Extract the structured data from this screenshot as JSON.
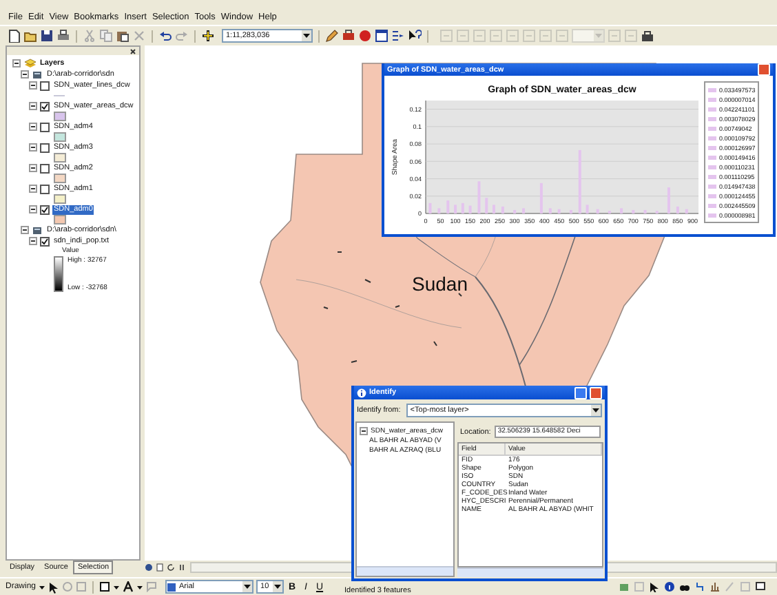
{
  "menu": [
    "File",
    "Edit",
    "View",
    "Bookmarks",
    "Insert",
    "Selection",
    "Tools",
    "Window",
    "Help"
  ],
  "standard_toolbar": {
    "scale": "1:11,283,036"
  },
  "editor_toolbar": {
    "disabled": true
  },
  "toc": {
    "tree": [
      {
        "label": "Layers",
        "kind": "frame",
        "expanded": true,
        "children": [
          {
            "label": "D:\\arab-corridor\\sdn",
            "kind": "folder",
            "expanded": true,
            "children": [
              {
                "label": "SDN_water_lines_dcw",
                "kind": "line-layer",
                "expanded": true,
                "checked": false,
                "selected": false,
                "color": "#c8c8d8"
              },
              {
                "label": "SDN_water_areas_dcw",
                "kind": "polygon-layer",
                "expanded": true,
                "checked": true,
                "selected": false,
                "color": "#d8c4ec"
              },
              {
                "label": "SDN_adm4",
                "kind": "polygon-layer",
                "expanded": true,
                "checked": false,
                "selected": false,
                "color": "#c4e6de"
              },
              {
                "label": "SDN_adm3",
                "kind": "polygon-layer",
                "expanded": true,
                "checked": false,
                "selected": false,
                "color": "#f4ecd6"
              },
              {
                "label": "SDN_adm2",
                "kind": "polygon-layer",
                "expanded": true,
                "checked": false,
                "selected": false,
                "color": "#f4d8c4"
              },
              {
                "label": "SDN_adm1",
                "kind": "polygon-layer",
                "expanded": true,
                "checked": false,
                "selected": false,
                "color": "#f4f0c8"
              },
              {
                "label": "SDN_adm0",
                "kind": "polygon-layer",
                "expanded": true,
                "checked": true,
                "selected": true,
                "color": "#f4c8b0"
              }
            ]
          },
          {
            "label": "D:\\arab-corridor\\sdn\\",
            "kind": "folder",
            "expanded": true,
            "children": [
              {
                "label": "sdn_indi_pop.txt",
                "kind": "raster-layer",
                "expanded": true,
                "checked": true,
                "selected": false,
                "legend_title": "Value",
                "high": "High : 32767",
                "low": "Low : -32768"
              }
            ]
          }
        ]
      }
    ],
    "tabs": [
      {
        "label": "Display",
        "selected": false
      },
      {
        "label": "Source",
        "selected": false
      },
      {
        "label": "Selection",
        "selected": true
      }
    ]
  },
  "map": {
    "label": "Sudan"
  },
  "graph_window": {
    "title": "Graph of SDN_water_areas_dcw",
    "chart_data": {
      "type": "bar",
      "title": "Graph of SDN_water_areas_dcw",
      "ylabel": "Shape Area",
      "x": [
        15,
        45,
        75,
        100,
        125,
        150,
        180,
        205,
        230,
        260,
        300,
        330,
        390,
        420,
        450,
        490,
        520,
        545,
        580,
        620,
        660,
        700,
        740,
        780,
        820,
        850,
        880
      ],
      "series": [
        {
          "color": "#e4c4ee",
          "values": [
            0.012,
            0.006,
            0.015,
            0.01,
            0.012,
            0.009,
            0.037,
            0.018,
            0.01,
            0.008,
            0.004,
            0.006,
            0.035,
            0.006,
            0.005,
            0.004,
            0.073,
            0.01,
            0.005,
            0.003,
            0.006,
            0.004,
            0.004,
            0.003,
            0.03,
            0.008,
            0.005
          ]
        }
      ],
      "xlim": [
        0,
        920
      ],
      "ylim": [
        0,
        0.13
      ],
      "grid": true,
      "xticks": [
        0,
        50,
        100,
        150,
        200,
        250,
        300,
        350,
        400,
        450,
        500,
        550,
        600,
        650,
        700,
        750,
        800,
        850,
        900
      ],
      "yticks": [
        0,
        0.02,
        0.04,
        0.06,
        0.08,
        0.1,
        0.12
      ]
    },
    "legend": [
      "0.033497573",
      "0.000007014",
      "0.042241101",
      "0.003078029",
      "0.00749042",
      "0.000109792",
      "0.000126997",
      "0.000149416",
      "0.000110231",
      "0.001110295",
      "0.014947438",
      "0.000124455",
      "0.002445509",
      "0.000008981"
    ]
  },
  "identify": {
    "title": "Identify",
    "from_label": "Identify from:",
    "from_value": "<Top-most layer>",
    "tree": [
      {
        "label": "SDN_water_areas_dcw",
        "expanded": true,
        "children": [
          {
            "label": "AL BAHR AL ABYAD (V"
          },
          {
            "label": "BAHR AL AZRAQ (BLU"
          }
        ]
      }
    ],
    "location_label": "Location:",
    "location": "32.506239 15.648582 Deci",
    "columns": [
      "Field",
      "Value"
    ],
    "rows": [
      [
        "FID",
        "176"
      ],
      [
        "Shape",
        "Polygon"
      ],
      [
        "ISO",
        "SDN"
      ],
      [
        "COUNTRY",
        "Sudan"
      ],
      [
        "F_CODE_DES",
        "Inland Water"
      ],
      [
        "HYC_DESCRI",
        "Perennial/Permanent"
      ],
      [
        "NAME",
        "AL BAHR AL ABYAD (WHIT"
      ]
    ]
  },
  "drawing_toolbar": {
    "menu": "Drawing",
    "font": "Arial",
    "size": "10",
    "bold": "B",
    "italic": "I",
    "underline": "U"
  },
  "status": "Identified 3 features"
}
